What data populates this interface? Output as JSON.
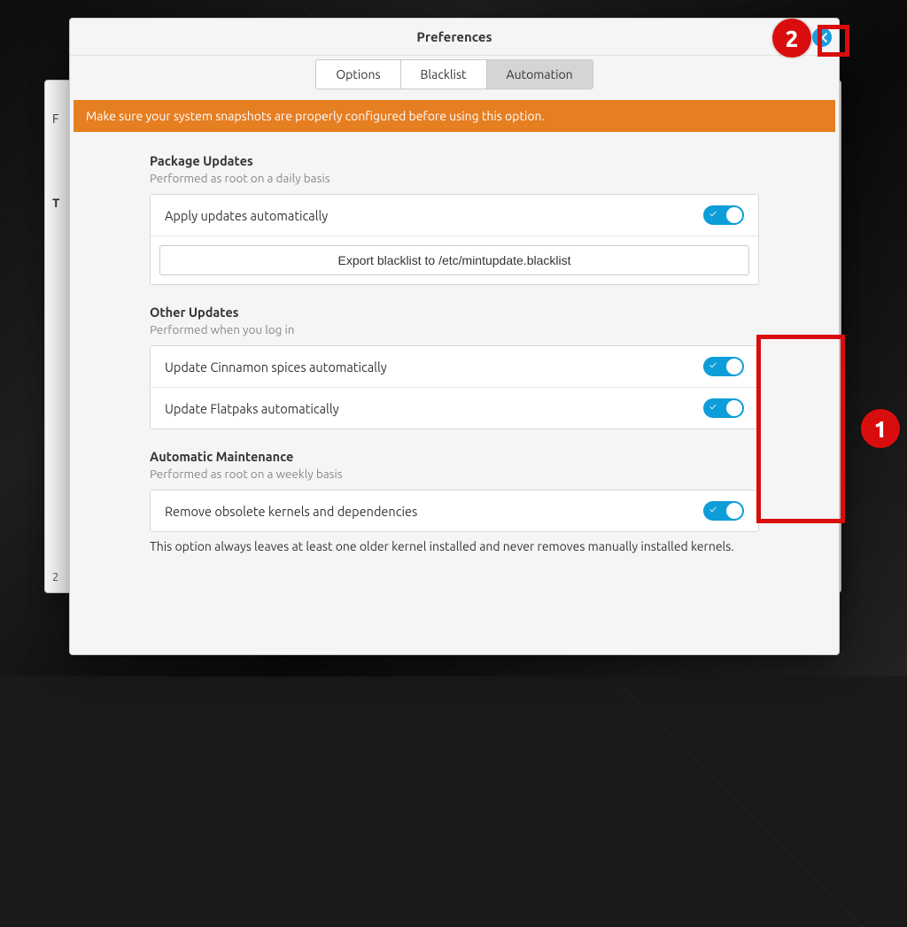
{
  "window": {
    "title": "Preferences",
    "tabs": [
      "Options",
      "Blacklist",
      "Automation"
    ],
    "active_tab": 2,
    "warning": "Make sure your system snapshots are properly configured before using this option."
  },
  "sections": {
    "package": {
      "title": "Package Updates",
      "subtitle": "Performed as root on a daily basis",
      "apply_label": "Apply updates automatically",
      "apply_on": true,
      "export_label": "Export blacklist to /etc/mintupdate.blacklist"
    },
    "other": {
      "title": "Other Updates",
      "subtitle": "Performed when you log in",
      "cinnamon_label": "Update Cinnamon spices automatically",
      "cinnamon_on": true,
      "flatpak_label": "Update Flatpaks automatically",
      "flatpak_on": true
    },
    "maintenance": {
      "title": "Automatic Maintenance",
      "subtitle": "Performed as root on a weekly basis",
      "remove_label": "Remove obsolete kernels and dependencies",
      "remove_on": true,
      "note": "This option always leaves at least one older kernel installed and never removes manually installed kernels."
    }
  },
  "behind": {
    "left_char": "F",
    "t_char": "T",
    "bottom_char": "2"
  },
  "annotations": {
    "badge1": "1",
    "badge2": "2"
  },
  "colors": {
    "accent": "#0d9dd8",
    "warning_bg": "#e67e22",
    "annotation": "#d90d0d"
  }
}
